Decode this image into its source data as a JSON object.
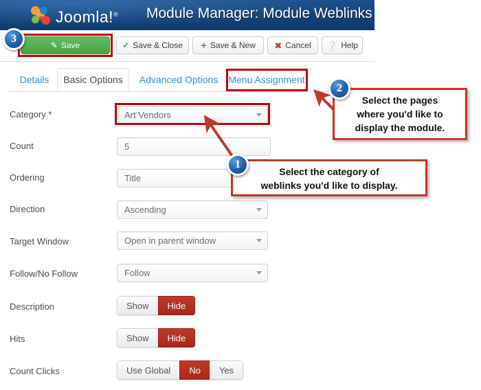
{
  "header": {
    "brand": "Joomla!",
    "brand_sup": "®",
    "title": "Module Manager: Module Weblinks",
    "logo_icon": "joomla-logo-icon"
  },
  "toolbar": {
    "save_label": "Save",
    "save_icon": "save-icon",
    "save_close_label": "Save & Close",
    "save_close_icon": "check-icon",
    "save_new_label": "Save & New",
    "save_new_icon": "plus-icon",
    "cancel_label": "Cancel",
    "cancel_icon": "cancel-circle-icon",
    "help_label": "Help",
    "help_icon": "help-circle-icon"
  },
  "tabs": [
    {
      "label": "Details",
      "active": false
    },
    {
      "label": "Basic Options",
      "active": true
    },
    {
      "label": "Advanced Options",
      "active": false
    },
    {
      "label": "Menu Assignment",
      "active": false
    }
  ],
  "form": {
    "fields": [
      {
        "label": "Category *",
        "type": "select",
        "value": "Art Vendors"
      },
      {
        "label": "Count",
        "type": "text",
        "value": "5"
      },
      {
        "label": "Ordering",
        "type": "select",
        "value": "Title"
      },
      {
        "label": "Direction",
        "type": "select",
        "value": "Ascending"
      },
      {
        "label": "Target Window",
        "type": "select",
        "value": "Open in parent window"
      },
      {
        "label": "Follow/No Follow",
        "type": "select",
        "value": "Follow"
      }
    ],
    "toggles": [
      {
        "label": "Description",
        "options": [
          {
            "text": "Show",
            "selected": false
          },
          {
            "text": "Hide",
            "selected": true
          }
        ]
      },
      {
        "label": "Hits",
        "options": [
          {
            "text": "Show",
            "selected": false
          },
          {
            "text": "Hide",
            "selected": true
          }
        ]
      },
      {
        "label": "Count Clicks",
        "options": [
          {
            "text": "Use Global",
            "selected": false
          },
          {
            "text": "No",
            "selected": true
          },
          {
            "text": "Yes",
            "selected": false
          }
        ]
      }
    ]
  },
  "annotations": {
    "badge_1": "1",
    "badge_2": "2",
    "badge_3": "3",
    "callout_1": "Select the category of\nweblinks you'd like to display.",
    "callout_2": "Select the pages\nwhere you'd like to\ndisplay the module."
  },
  "colors": {
    "header_blue": "#17437a",
    "save_green": "#45a545",
    "highlight_red": "#c00000",
    "callout_red": "#c0392b",
    "toggle_active_red": "#b02b20",
    "tab_link_blue": "#2a93d5",
    "badge_blue": "#1f5fa8"
  }
}
